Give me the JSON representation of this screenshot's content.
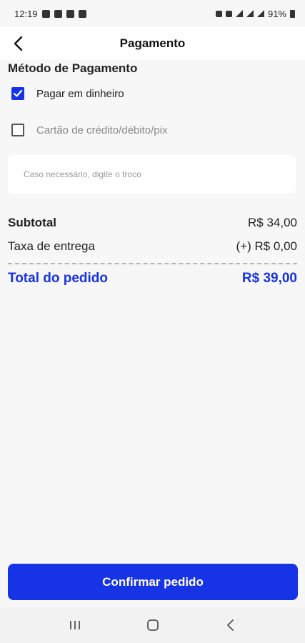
{
  "status_bar": {
    "time": "12:19",
    "battery": "91%"
  },
  "header": {
    "title": "Pagamento",
    "back_icon": "chevron-left-icon"
  },
  "payment_method": {
    "section_title": "Método de Pagamento",
    "options": [
      {
        "label": "Pagar em dinheiro",
        "checked": true
      },
      {
        "label": "Cartão de crédito/débito/pix",
        "checked": false
      }
    ],
    "change_field": {
      "value": "",
      "placeholder": "Caso necessário, digite o troco"
    }
  },
  "summary": {
    "subtotal_label": "Subtotal",
    "subtotal_value": "R$ 34,00",
    "delivery_label": "Taxa de entrega",
    "delivery_value": "(+) R$ 0,00",
    "total_label": "Total do pedido",
    "total_value": "R$ 39,00"
  },
  "actions": {
    "confirm_label": "Confirmar pedido"
  },
  "colors": {
    "accent": "#1733e6",
    "background": "#f7f7f7"
  }
}
